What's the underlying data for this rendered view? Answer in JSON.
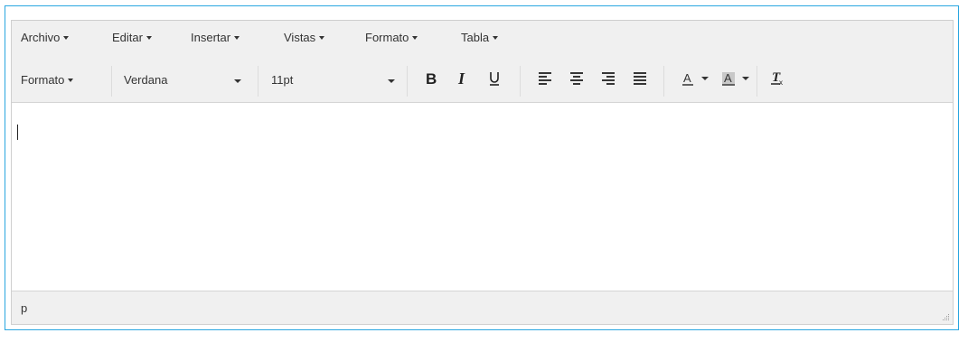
{
  "menubar": {
    "items": [
      {
        "label": "Archivo"
      },
      {
        "label": "Editar"
      },
      {
        "label": "Insertar"
      },
      {
        "label": "Vistas"
      },
      {
        "label": "Formato"
      },
      {
        "label": "Tabla"
      }
    ]
  },
  "toolbar": {
    "format_label": "Formato",
    "font_family": "Verdana",
    "font_size": "11pt",
    "buttons": [
      "bold",
      "italic",
      "underline",
      "align-left",
      "align-center",
      "align-right",
      "align-justify",
      "text-color",
      "background-color",
      "clear-formatting"
    ]
  },
  "statusbar": {
    "path": "p"
  },
  "colors": {
    "focus_border": "#2aa6e0",
    "toolbar_bg": "#f0f0f0"
  }
}
